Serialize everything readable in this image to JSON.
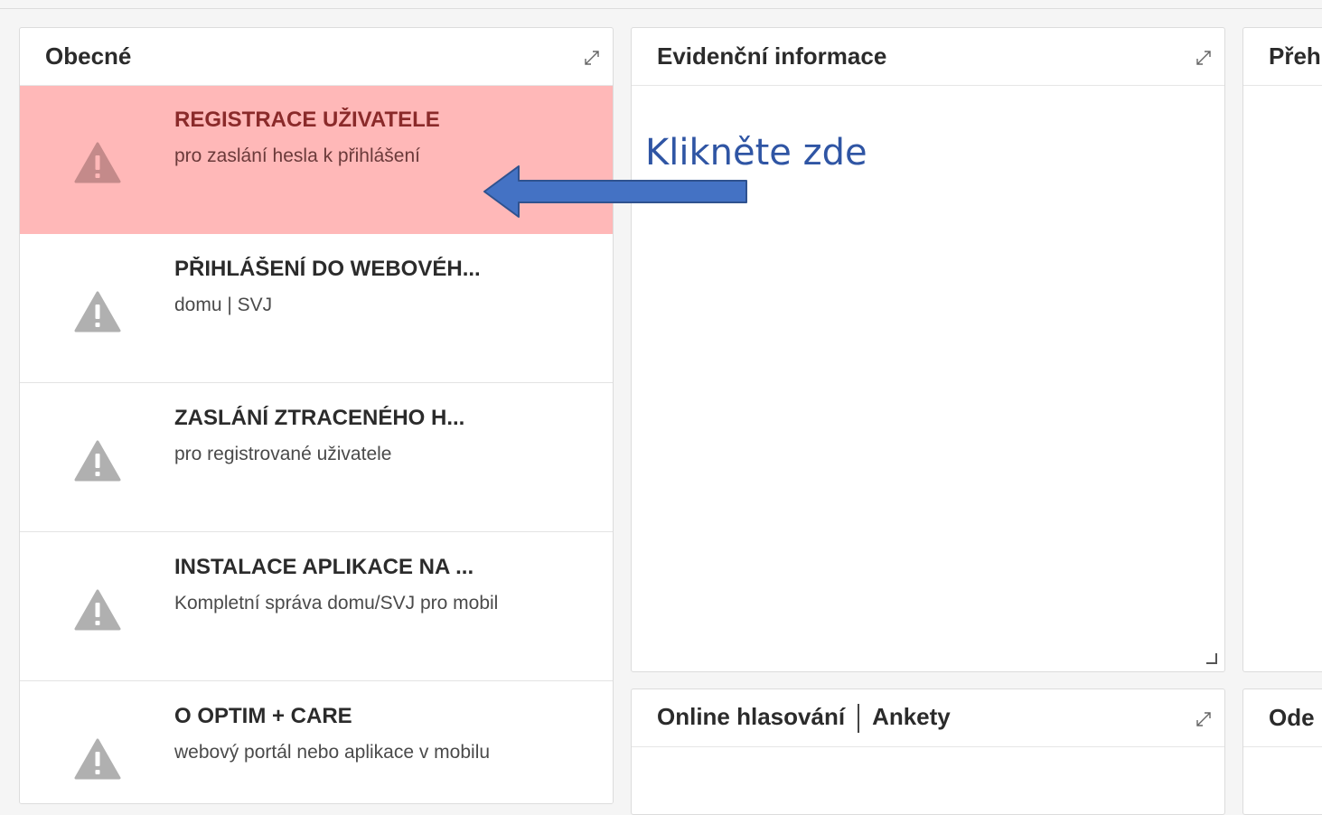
{
  "panels": {
    "general": {
      "title": "Obecné",
      "items": [
        {
          "title": "REGISTRACE UŽIVATELE",
          "subtitle": "pro zaslání hesla k přihlášení"
        },
        {
          "title": "PŘIHLÁŠENÍ DO WEBOVÉH...",
          "subtitle": "domu | SVJ"
        },
        {
          "title": "ZASLÁNÍ ZTRACENÉHO H...",
          "subtitle": "pro registrované uživatele"
        },
        {
          "title": "INSTALACE APLIKACE NA ...",
          "subtitle": "Kompletní správa domu/SVJ pro mobil"
        },
        {
          "title": "O OPTIM + CARE",
          "subtitle": "webový portál nebo aplikace v mobilu"
        }
      ]
    },
    "records": {
      "title": "Evidenční informace"
    },
    "overview": {
      "title": "Přeh"
    },
    "voting": {
      "title_part1": "Online hlasování",
      "title_part2": "Ankety"
    },
    "other": {
      "title": "Ode"
    }
  },
  "annotation": {
    "text": "Klikněte zde"
  },
  "colors": {
    "active_item_bg": "#ffb8b8",
    "warning_icon": "#b0b0b0",
    "warning_icon_active": "#c48a8a",
    "annotation_blue": "#4472c4"
  }
}
